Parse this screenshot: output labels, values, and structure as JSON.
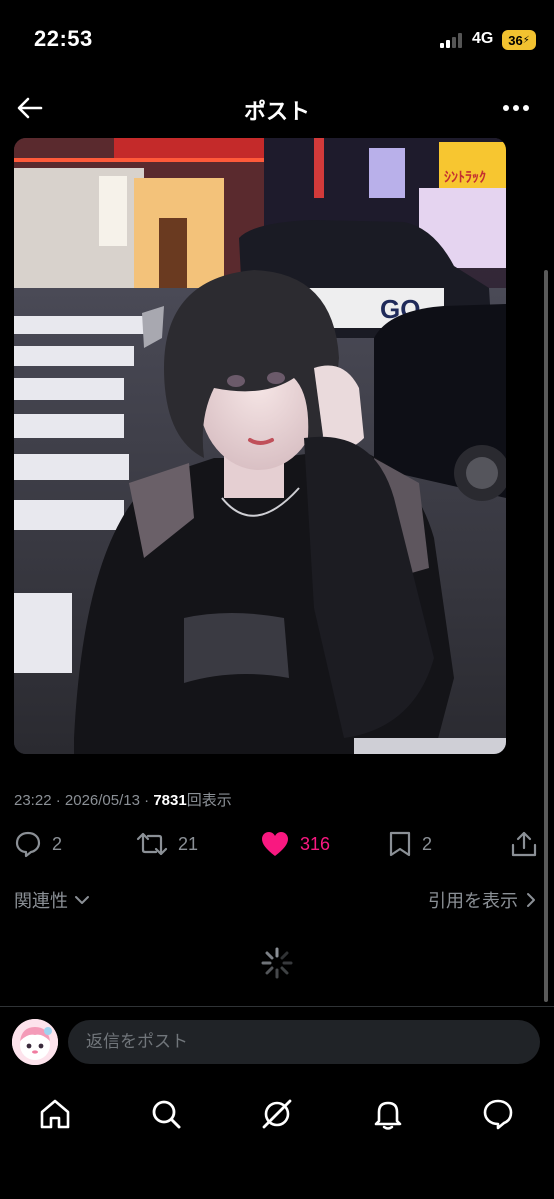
{
  "status_bar": {
    "time": "22:53",
    "network": "4G",
    "battery": "36"
  },
  "header": {
    "title": "ポスト",
    "back_icon": "arrow-left-icon",
    "more_icon": "more-horizontal-icon"
  },
  "post": {
    "time": "23:22",
    "date": "2026/05/13",
    "separator": "·",
    "view_count": "7831",
    "views_label": "回表示",
    "photo_signs": {
      "taxi_logo": "GO",
      "store_sign": "ｼﾝﾄﾗｯｸ"
    }
  },
  "actions": {
    "reply_count": "2",
    "repost_count": "21",
    "like_count": "316",
    "bookmark_count": "2"
  },
  "replies": {
    "sort_label": "関連性",
    "quotes_label": "引用を表示"
  },
  "reply_box": {
    "placeholder": "返信をポスト"
  },
  "colors": {
    "like": "#f91880",
    "muted": "#8b9096",
    "background": "#000000",
    "input_bg": "#202327"
  },
  "tabbar": {
    "items": [
      "home-icon",
      "search-icon",
      "grok-icon",
      "notifications-icon",
      "messages-icon"
    ]
  }
}
